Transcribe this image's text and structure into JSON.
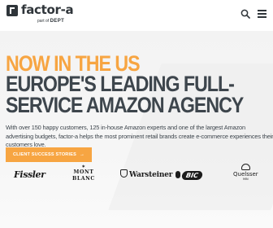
{
  "header": {
    "logo_text": "factor-a",
    "logo_sub_prefix": "part of",
    "logo_sub_brand": "DEPT"
  },
  "hero": {
    "headline_orange": "NOW IN THE US",
    "headline_line1": "EUROPE'S LEADING FULL-",
    "headline_line2": "SERVICE AMAZON AGENCY",
    "body": "With over 150 happy customers, 125 in-house Amazon experts and one of the largest Amazon advertising budgets, factor-a helps the most prominent retail brands create e-commerce experiences their customers love.",
    "cta_label": "CLIENT SUCCESS STORIES",
    "cta_arrow": "→"
  },
  "brands": {
    "fissler": "Fissler",
    "montblanc_star": "✶",
    "montblanc_line1": "MONT",
    "montblanc_line2": "BLANC",
    "warsteiner": "Warsteiner",
    "bic": "BIC",
    "quelsser": "Quelsser",
    "quelsser_sub": "MIN",
    "next_arrow": "›"
  },
  "colors": {
    "accent": "#f7a542",
    "text_dark": "#3d454c",
    "cta_text": "#ffffff"
  },
  "icons": [
    "search-icon",
    "menu-icon",
    "arrow-right-icon"
  ]
}
